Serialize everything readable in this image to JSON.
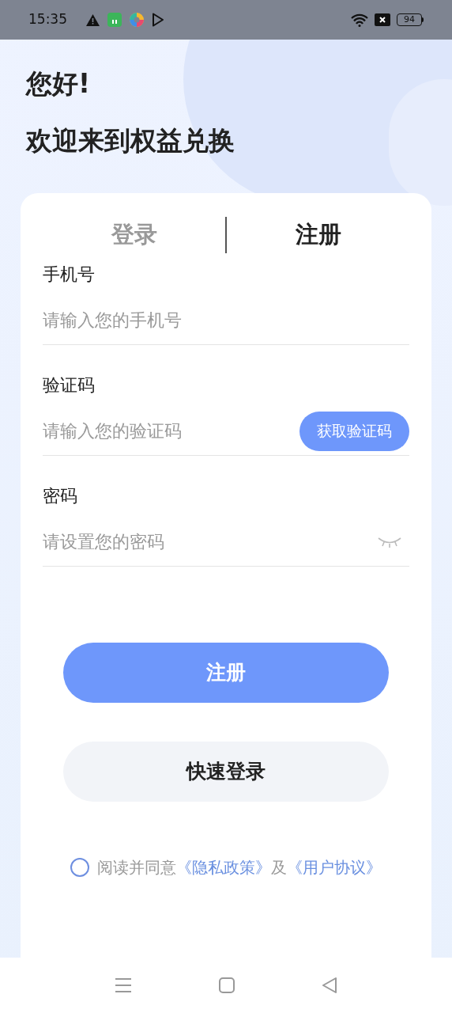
{
  "status_bar": {
    "time": "15:35",
    "battery": "94"
  },
  "greeting": "您好!",
  "title": "欢迎来到权益兑换",
  "tabs": [
    {
      "label": "登录",
      "selected": false
    },
    {
      "label": "注册",
      "selected": true
    }
  ],
  "fields": [
    {
      "kind": "text",
      "label": "手机号",
      "placeholder": "请输入您的手机号"
    },
    {
      "kind": "code",
      "label": "验证码",
      "placeholder": "请输入您的验证码",
      "action": "获取验证码"
    },
    {
      "kind": "password",
      "label": "密码",
      "placeholder": "请设置您的密码"
    }
  ],
  "primary_button": "注册",
  "secondary_button": "快速登录",
  "agreement": {
    "checked": false,
    "text": "阅读并同意",
    "link_1": "《隐私政策》",
    "joiner": "及",
    "link_2": "《用户协议》"
  }
}
